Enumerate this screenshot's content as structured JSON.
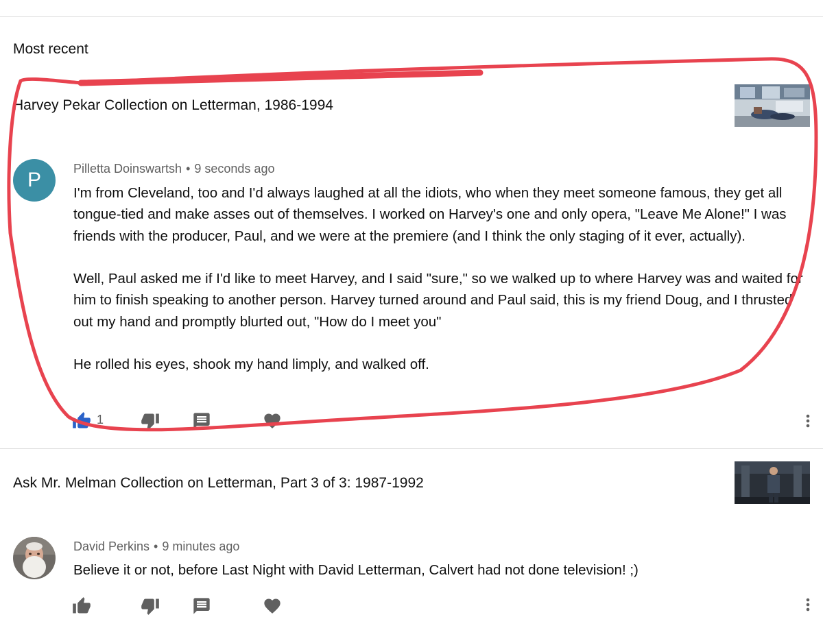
{
  "section_title": "Most recent",
  "items": [
    {
      "video_title": "Harvey Pekar Collection on Letterman, 1986-1994",
      "avatar_letter": "P",
      "author": "Pilletta Doinswartsh",
      "separator": "•",
      "time": "9 seconds ago",
      "paragraphs": [
        "I'm from Cleveland, too and I'd always laughed at all the idiots, who when they meet someone famous, they get all tongue-tied and make asses out of themselves.  I worked on Harvey's one and only opera, \"Leave Me Alone!\" I was friends with the producer, Paul, and we were at the premiere (and I think the only staging of it ever, actually).",
        "Well, Paul asked me if I'd like to meet Harvey, and I said \"sure,\" so we walked up to where Harvey was and waited for him to finish speaking to another person.  Harvey turned around and Paul said, this is my friend Doug, and I thrusted out my hand and promptly blurted out, \"How do I meet you\"",
        "He rolled his eyes, shook my hand limply, and walked off."
      ],
      "like_count": "1",
      "liked": true,
      "icons": [
        "like-icon",
        "dislike-icon",
        "reply-icon",
        "heart-icon",
        "more-vert-icon"
      ],
      "colors": {
        "liked": "#2a62c9",
        "avatar": "#3b8fa5",
        "annotation": "#e8434f"
      }
    },
    {
      "video_title": "Ask Mr. Melman Collection on Letterman, Part 3 of 3: 1987-1992",
      "author": "David Perkins",
      "separator": "•",
      "time": "9 minutes ago",
      "paragraphs": [
        "Believe it or not, before Last Night with David Letterman, Calvert had not done television! ;)"
      ],
      "liked": false,
      "icons": [
        "like-icon",
        "dislike-icon",
        "reply-icon",
        "heart-icon",
        "more-vert-icon"
      ]
    }
  ]
}
